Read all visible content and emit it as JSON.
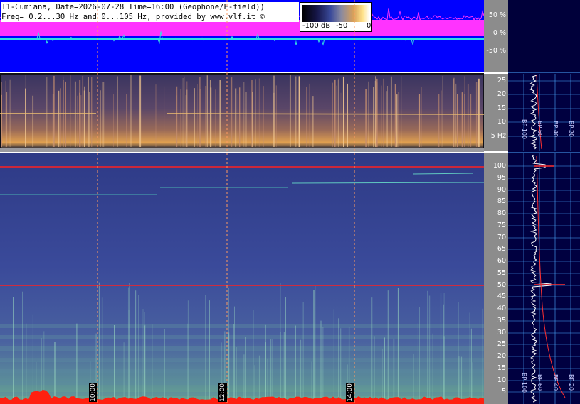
{
  "header": {
    "line1": "I1-Cumiana, Date=2026-07-28 Time=16:00 (Geophone/E-field))",
    "line2": "Freq= 0.2...30 Hz and 0...105 Hz, provided by www.vlf.it ©"
  },
  "colorbar": {
    "label_low": "-100 dB",
    "label_mid": "-50",
    "label_high": "0"
  },
  "waveform_axis": {
    "ticks": [
      {
        "label": "50 %",
        "value": 50
      },
      {
        "label": "0 %",
        "value": 0
      },
      {
        "label": "-50 %",
        "value": -50
      }
    ]
  },
  "low_spectrogram_axis": {
    "ticks": [
      {
        "label": "25",
        "value": 25
      },
      {
        "label": "20",
        "value": 20
      },
      {
        "label": "15",
        "value": 15
      },
      {
        "label": "10",
        "value": 10
      },
      {
        "label": "5 Hz",
        "value": 5
      }
    ]
  },
  "high_spectrogram_axis": {
    "ticks": [
      {
        "label": "100",
        "value": 100
      },
      {
        "label": "95",
        "value": 95
      },
      {
        "label": "90",
        "value": 90
      },
      {
        "label": "85",
        "value": 85
      },
      {
        "label": "80",
        "value": 80
      },
      {
        "label": "75",
        "value": 75
      },
      {
        "label": "70",
        "value": 70
      },
      {
        "label": "65",
        "value": 65
      },
      {
        "label": "60",
        "value": 60
      },
      {
        "label": "55",
        "value": 55
      },
      {
        "label": "50",
        "value": 50
      },
      {
        "label": "45",
        "value": 45
      },
      {
        "label": "40",
        "value": 40
      },
      {
        "label": "35",
        "value": 35
      },
      {
        "label": "30",
        "value": 30
      },
      {
        "label": "25",
        "value": 25
      },
      {
        "label": "20",
        "value": 20
      },
      {
        "label": "15",
        "value": 15
      },
      {
        "label": "10",
        "value": 10
      },
      {
        "label": "5",
        "value": 5
      }
    ]
  },
  "time_markers": [
    {
      "label": "10:00"
    },
    {
      "label": "12:00"
    },
    {
      "label": "14:00"
    }
  ],
  "bp_panel": {
    "top_labels": [
      "BP 100",
      "BP 60",
      "BP 40",
      "BP 20"
    ],
    "bottom_labels": [
      "BP 100",
      "BP 60",
      "BP 40",
      "BP 20"
    ]
  },
  "colors": {
    "waveform_bg": "#0000ff",
    "waveform_trace": "#ff33ff",
    "waveform_center": "#33e0e0",
    "spectrogram_bg": "#3a4a9a",
    "axis_bg": "#8c8c8c",
    "bp_bg": "#000040",
    "red_line": "#ff2020",
    "grid": "#4aa8ff"
  }
}
